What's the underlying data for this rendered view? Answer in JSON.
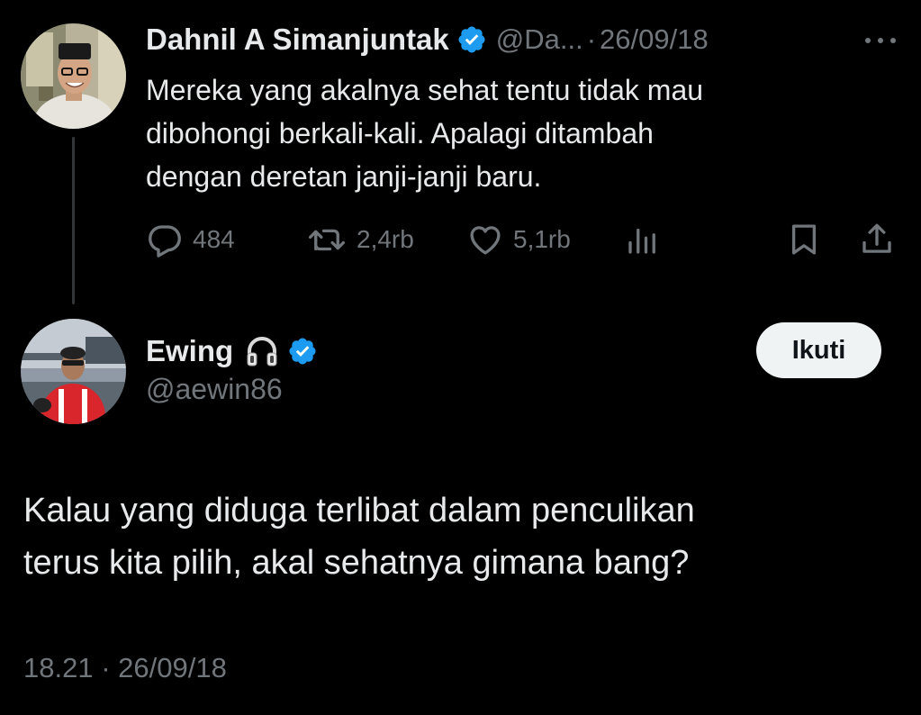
{
  "parent_tweet": {
    "author_name": "Dahnil A Simanjuntak",
    "handle": "@Da...",
    "separator": "·",
    "date": "26/09/18",
    "text_lines": [
      "Mereka yang akalnya sehat tentu tidak mau",
      "dibohongi berkali-kali. Apalagi ditambah",
      "dengan deretan janji-janji baru."
    ],
    "stats": {
      "replies": "484",
      "retweets": "2,4rb",
      "likes": "5,1rb"
    },
    "icons": [
      "verified-badge-icon",
      "more-icon",
      "reply-icon",
      "retweet-icon",
      "like-icon",
      "views-icon",
      "bookmark-icon",
      "share-icon"
    ]
  },
  "reply_tweet": {
    "author_name": "Ewing",
    "handle": "@aewin86",
    "follow_label": "Ikuti",
    "text_lines": [
      "Kalau yang diduga terlibat dalam penculikan",
      "terus kita pilih, akal sehatnya gimana bang?"
    ],
    "time": "18.21",
    "separator": "·",
    "date": "26/09/18",
    "icons": [
      "headphones-icon",
      "verified-badge-icon"
    ]
  },
  "colors": {
    "background": "#000000",
    "primary_text": "#e7e9ea",
    "secondary_text": "#71767b",
    "verified_blue": "#1d9bf0",
    "thread_line": "#333639",
    "follow_button_bg": "#eff3f4"
  }
}
